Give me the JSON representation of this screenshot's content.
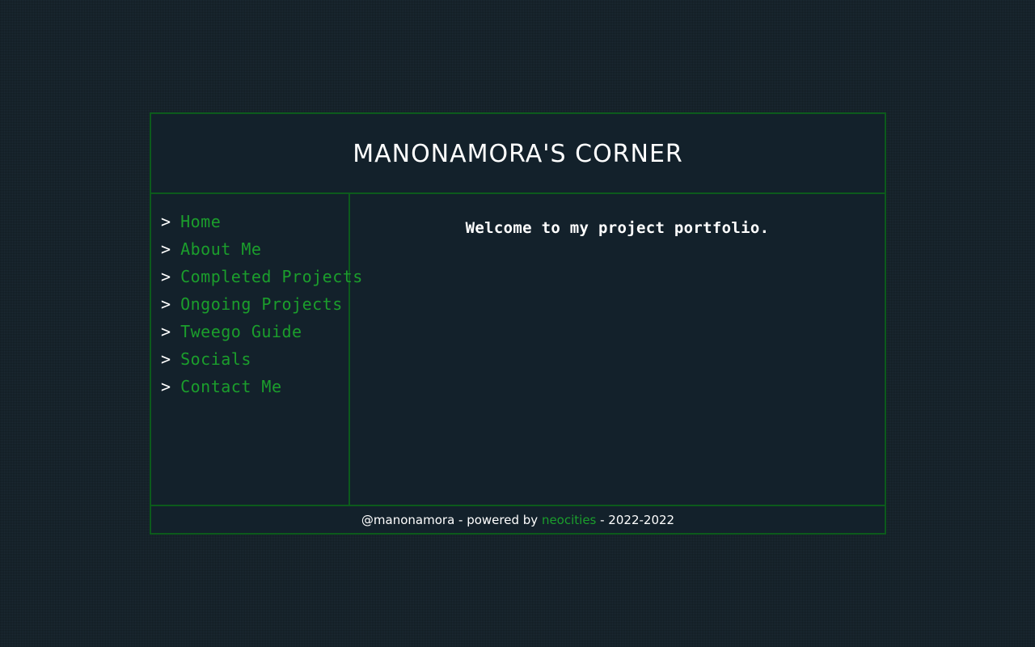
{
  "header": {
    "title": "MANONAMORA'S CORNER"
  },
  "sidebar": {
    "arrow": ">",
    "items": [
      {
        "label": "Home"
      },
      {
        "label": "About Me"
      },
      {
        "label": "Completed Projects"
      },
      {
        "label": "Ongoing Projects"
      },
      {
        "label": "Tweego Guide"
      },
      {
        "label": "Socials"
      },
      {
        "label": "Contact Me"
      }
    ]
  },
  "main": {
    "welcome": "Welcome to my project portfolio."
  },
  "footer": {
    "prefix": "@manonamora - powered by ",
    "link": "neocities",
    "suffix": " - 2022-2022"
  },
  "colors": {
    "background": "#1b2a33",
    "panel": "#13212b",
    "border": "#0c5a1c",
    "link": "#1b9e2c",
    "text": "#ffffff"
  }
}
